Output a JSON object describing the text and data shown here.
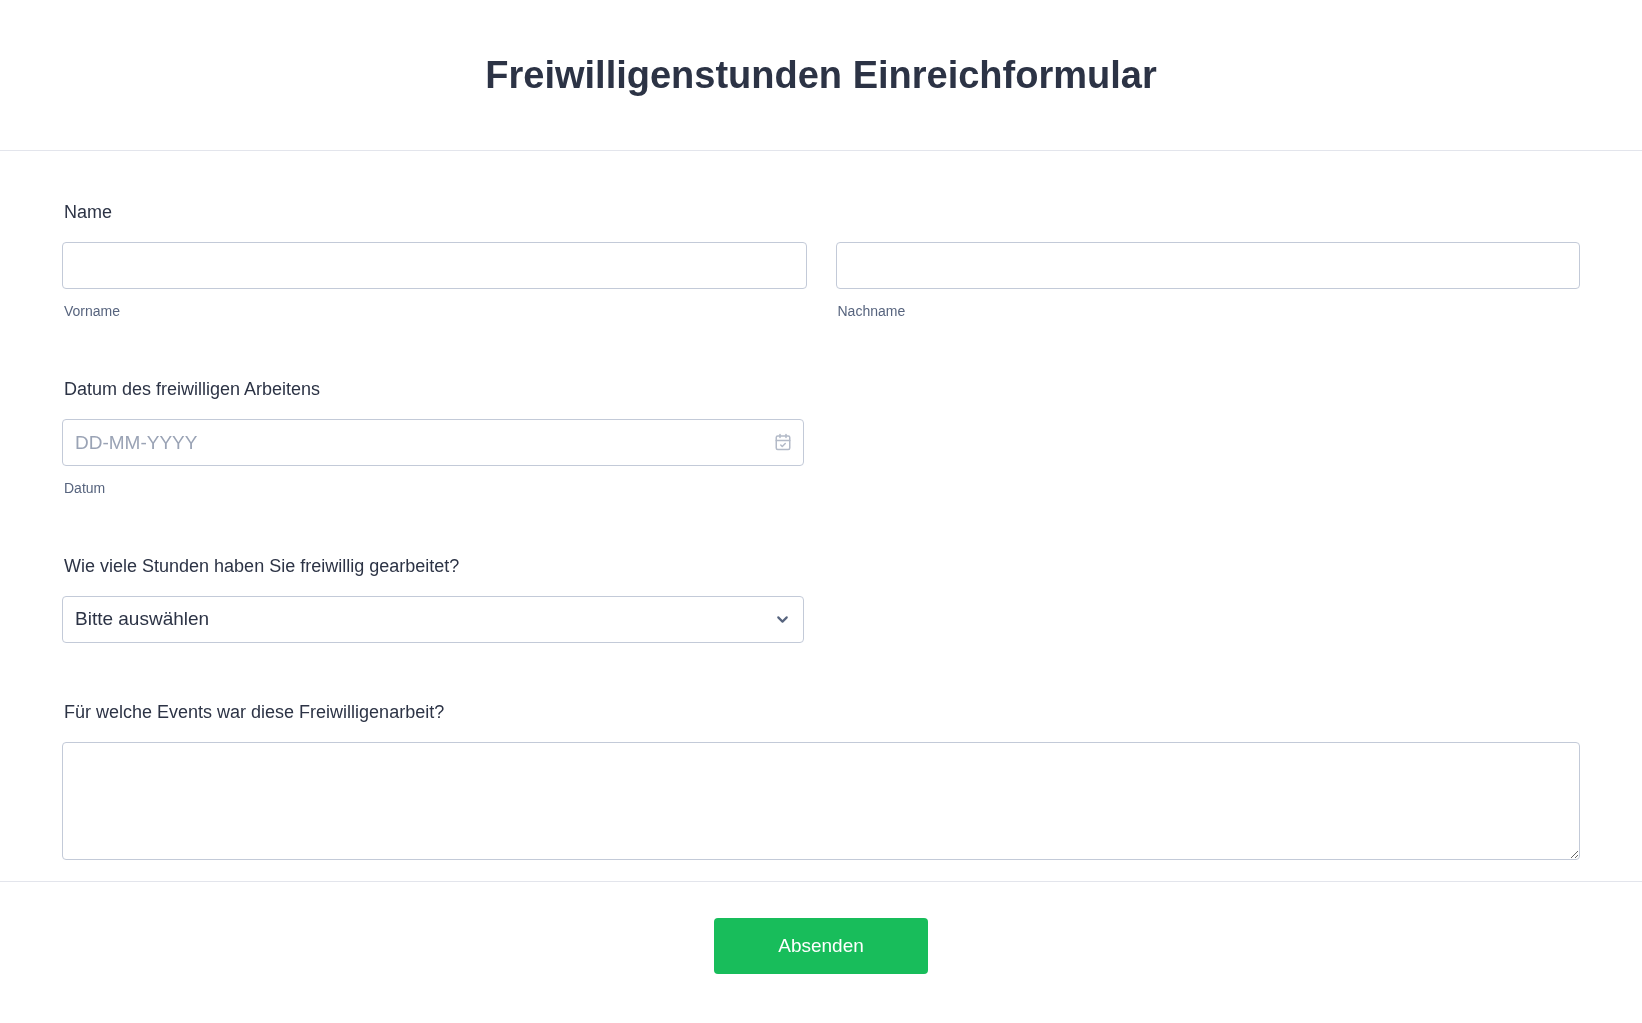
{
  "title": "Freiwilligenstunden Einreichformular",
  "name": {
    "label": "Name",
    "fields": [
      {
        "sublabel": "Vorname"
      },
      {
        "sublabel": "Nachname"
      }
    ]
  },
  "date": {
    "label": "Datum des freiwilligen Arbeitens",
    "placeholder": "DD-MM-YYYY",
    "sublabel": "Datum"
  },
  "hours": {
    "label": "Wie viele Stunden haben Sie freiwillig gearbeitet?",
    "value": "Bitte auswählen"
  },
  "events": {
    "label": "Für welche Events war diese Freiwilligenarbeit?"
  },
  "submit": "Absenden"
}
